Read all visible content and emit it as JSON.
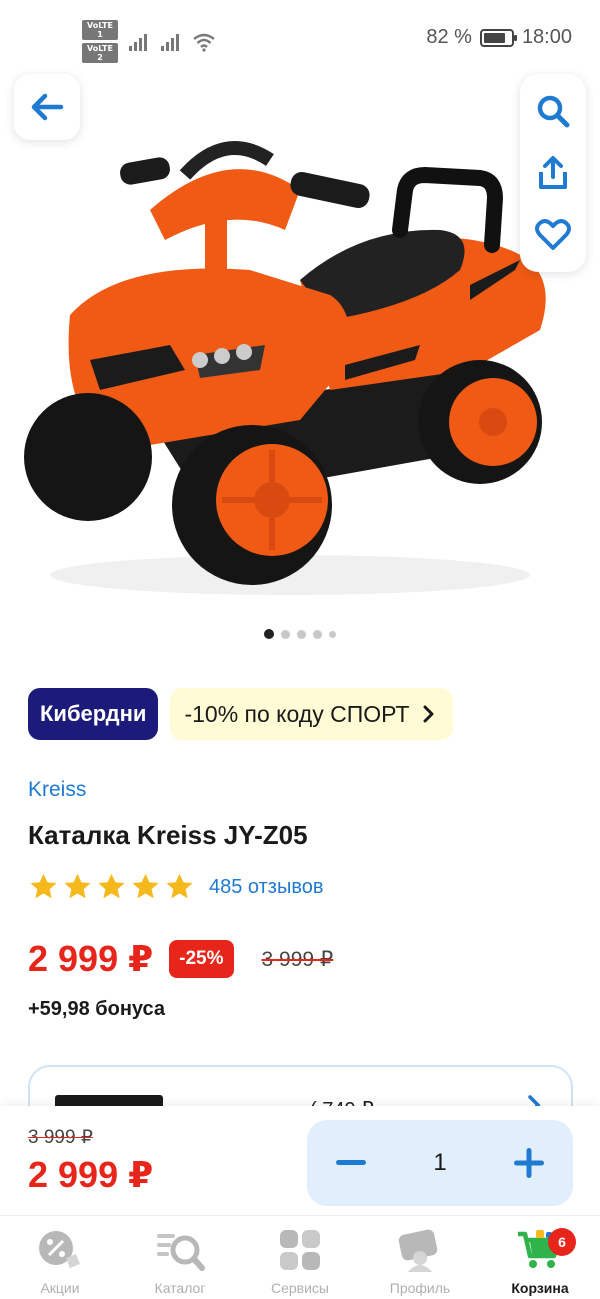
{
  "status_bar": {
    "sim1": "VoLTE 1",
    "sim2": "VoLTE 2",
    "battery_percent": "82 %",
    "battery_level": 0.82,
    "time": "18:00"
  },
  "icons": {
    "back": "arrow-left-icon",
    "search": "search-icon",
    "share": "share-icon",
    "favorite": "heart-icon"
  },
  "gallery": {
    "count": 5,
    "active_index": 0
  },
  "promo": {
    "tag": "Кибердни",
    "code_text": "-10% по коду СПОРТ",
    "chevron": "›"
  },
  "product": {
    "brand": "Kreiss",
    "title": "Каталка Kreiss JY-Z05",
    "rating": 5,
    "reviews": "485 отзывов",
    "price": "2 999 ₽",
    "discount": "-25%",
    "old_price": "3 999 ₽",
    "bonus": "+59,98 бонуса"
  },
  "delivery_card": {
    "partial_text": "( 749 ₽"
  },
  "buy_panel": {
    "old_price": "3 999 ₽",
    "price": "2 999 ₽",
    "minus": "−",
    "quantity": "1",
    "plus": "+"
  },
  "tabs": [
    {
      "label": "Акции",
      "icon": "percent-tag-icon"
    },
    {
      "label": "Каталог",
      "icon": "catalog-search-icon"
    },
    {
      "label": "Сервисы",
      "icon": "services-grid-icon"
    },
    {
      "label": "Профиль",
      "icon": "profile-card-icon"
    },
    {
      "label": "Корзина",
      "icon": "cart-icon",
      "badge": "6",
      "active": true
    }
  ],
  "colors": {
    "accent_blue": "#1f7ad1",
    "price_red": "#e8251a",
    "promo_navy": "#1c1a7a",
    "promo_yellow": "#fffbd5",
    "star_yellow": "#f6b91d",
    "cart_green": "#2fb34a"
  }
}
